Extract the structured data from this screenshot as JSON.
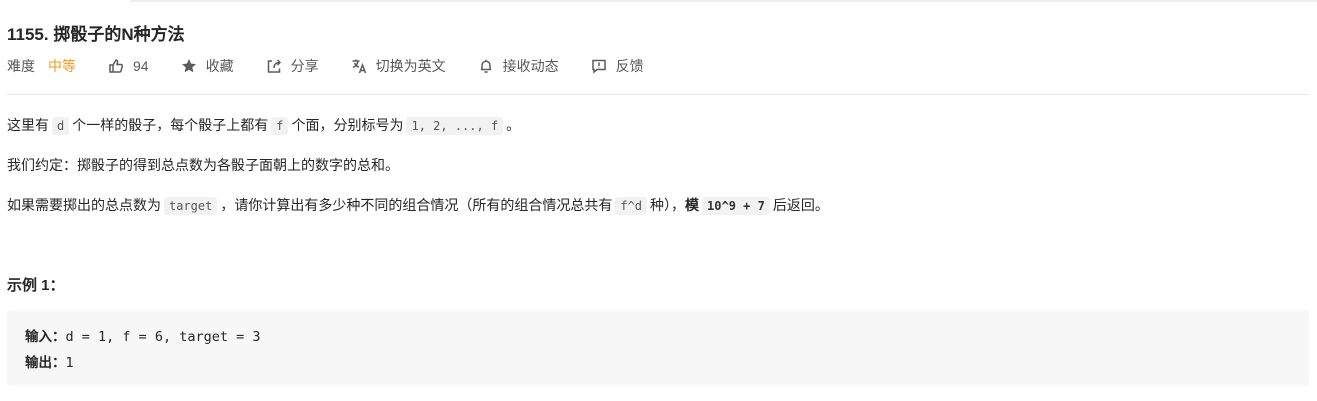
{
  "problem": {
    "title": "1155. 掷骰子的N种方法",
    "difficulty_label": "难度",
    "difficulty_value": "中等",
    "likes": "94",
    "favorite": "收藏",
    "share": "分享",
    "switch_lang": "切换为英文",
    "subscribe": "接收动态",
    "feedback": "反馈"
  },
  "description": {
    "p1": {
      "t1": "这里有",
      "c1": "d",
      "t2": "个一样的骰子，每个骰子上都有",
      "c2": "f",
      "t3": "个面，分别标号为",
      "c3": "1, 2, ..., f",
      "t4": "。"
    },
    "p2": "我们约定：掷骰子的得到总点数为各骰子面朝上的数字的总和。",
    "p3": {
      "t1": "如果需要掷出的总点数为",
      "c1": "target",
      "t2": "，请你计算出有多少种不同的组合情况（所有的组合情况总共有",
      "c2": "f^d",
      "t3": "种），",
      "bold": "模",
      "c3": "10^9 + 7",
      "t4": "后返回。"
    }
  },
  "example": {
    "title": "示例 1：",
    "input_label": "输入：",
    "input_value": "d = 1, f = 6, target = 3",
    "output_label": "输出：",
    "output_value": "1"
  },
  "icons": {
    "like": "thumbs-up-icon",
    "favorite": "star-icon",
    "share": "share-icon",
    "switch_lang": "translate-icon",
    "subscribe": "bell-icon",
    "feedback": "feedback-icon"
  },
  "colors": {
    "difficulty_medium": "#ef9c1f",
    "text": "#262626",
    "code_bg": "#f2f2f2",
    "example_bg": "#f7f7f7"
  }
}
